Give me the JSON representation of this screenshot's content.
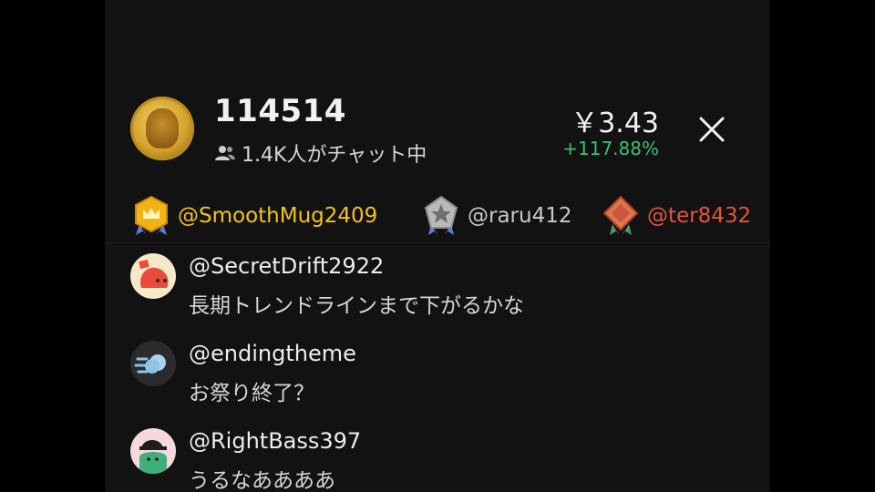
{
  "coin": {
    "title": "114514",
    "chat_count": "1.4K人がチャット中",
    "price": "￥3.43",
    "change": "+117.88%",
    "change_color": "#3fbf6e"
  },
  "ranking": [
    {
      "rank": 1,
      "name": "@SmoothMug2409",
      "badge": "gold-crown-badge-icon",
      "color": "#f0c419"
    },
    {
      "rank": 2,
      "name": "@raru412",
      "badge": "silver-star-badge-icon",
      "color": "#c9c9c9"
    },
    {
      "rank": 3,
      "name": "@ter8432",
      "badge": "bronze-badge-icon",
      "color": "#e5533a"
    }
  ],
  "messages": [
    {
      "user": "@SecretDrift2922",
      "text": "長期トレンドラインまで下がるかな",
      "avatar": "red-blob-avatar-icon"
    },
    {
      "user": "@endingtheme",
      "text": "お祭り終了？",
      "avatar": "blue-wind-avatar-icon"
    },
    {
      "user": "@RightBass397",
      "text": "うるなああああ",
      "avatar": "green-hat-avatar-icon"
    }
  ]
}
